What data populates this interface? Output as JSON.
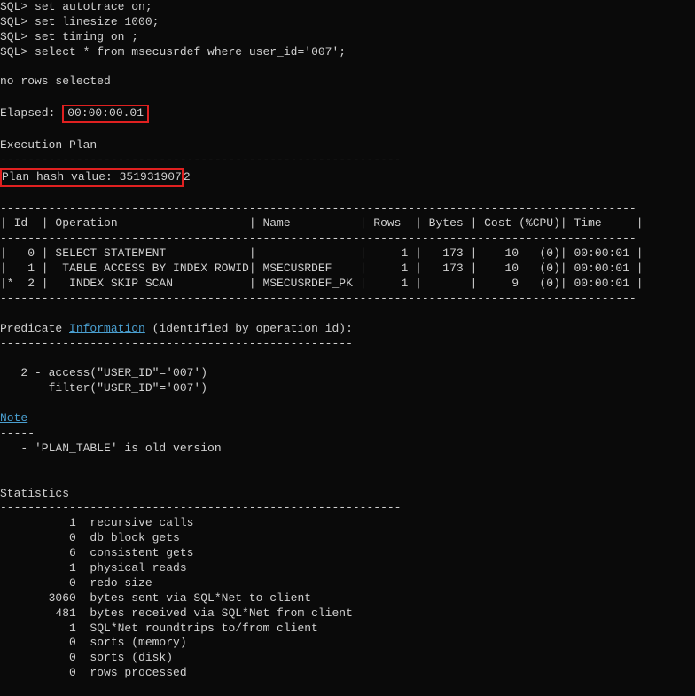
{
  "sql_lines": {
    "line1_prompt": "SQL> ",
    "line1_cmd": "set autotrace on;",
    "line2_prompt": "SQL> ",
    "line2_cmd": "set linesize 1000;",
    "line3_prompt": "SQL> ",
    "line3_cmd": "set timing on ;",
    "line4_prompt": "SQL> ",
    "line4_cmd": "select * from msecusrdef where user_id='007';"
  },
  "result": {
    "no_rows": "no rows selected",
    "elapsed_label": "Elapsed: ",
    "elapsed_value": "00:00:00.01"
  },
  "exec_plan": {
    "title": "Execution Plan",
    "divider": "----------------------------------------------------------",
    "hash_label": "Plan hash value: 351931907",
    "hash_suffix": "2",
    "table_border": "--------------------------------------------------------------------------------------------",
    "header": "| Id  | Operation                   | Name          | Rows  | Bytes | Cost (%CPU)| Time     |",
    "row0": "|   0 | SELECT STATEMENT            |               |     1 |   173 |    10   (0)| 00:00:01 |",
    "row1": "|   1 |  TABLE ACCESS BY INDEX ROWID| MSECUSRDEF    |     1 |   173 |    10   (0)| 00:00:01 |",
    "row2": "|*  2 |   INDEX SKIP SCAN           | MSECUSRDEF_PK |     1 |       |     9   (0)| 00:00:01 |"
  },
  "predicate": {
    "prefix": "Predicate ",
    "info_link": "Information",
    "suffix": " (identified by operation id):",
    "divider": "---------------------------------------------------",
    "access": "   2 - access(\"USER_ID\"='007')",
    "filter": "       filter(\"USER_ID\"='007')"
  },
  "note": {
    "label": "Note",
    "divider": "-----",
    "content": "   - 'PLAN_TABLE' is old version"
  },
  "statistics": {
    "title": "Statistics",
    "divider": "----------------------------------------------------------",
    "s1": "          1  recursive calls",
    "s2": "          0  db block gets",
    "s3": "          6  consistent gets",
    "s4": "          1  physical reads",
    "s5": "          0  redo size",
    "s6": "       3060  bytes sent via SQL*Net to client",
    "s7": "        481  bytes received via SQL*Net from client",
    "s8": "          1  SQL*Net roundtrips to/from client",
    "s9": "          0  sorts (memory)",
    "s10": "          0  sorts (disk)",
    "s11": "          0  rows processed"
  }
}
